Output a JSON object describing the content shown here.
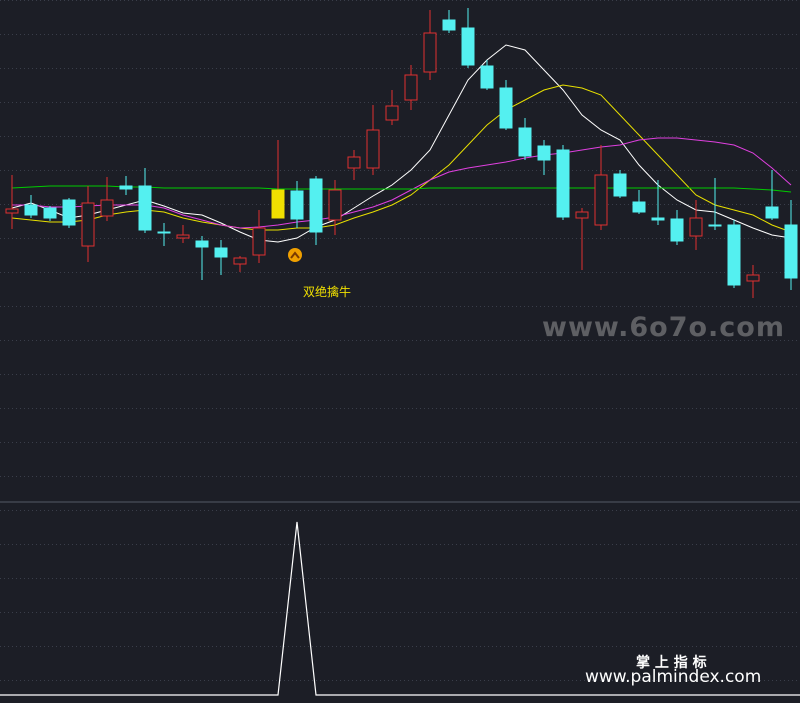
{
  "chart_data": [
    {
      "type": "candlestick",
      "panel": "price",
      "annotation": {
        "text": "双绝擒牛",
        "color": "#f0e000",
        "at_index": 15
      },
      "marker": {
        "type": "up-arrow-circle",
        "color": "#f0a000",
        "at_index": 15
      },
      "candles": [
        {
          "o": 209,
          "c": 213,
          "h": 229,
          "l": 175,
          "up": true
        },
        {
          "o": 205,
          "c": 215,
          "h": 218,
          "l": 195,
          "up": false
        },
        {
          "o": 208,
          "c": 218,
          "h": 221,
          "l": 206,
          "up": false
        },
        {
          "o": 200,
          "c": 225,
          "h": 228,
          "l": 198,
          "up": false
        },
        {
          "o": 203,
          "c": 246,
          "h": 262,
          "l": 186,
          "up": true
        },
        {
          "o": 200,
          "c": 216,
          "h": 221,
          "l": 177,
          "up": true
        },
        {
          "o": 186,
          "c": 189,
          "h": 195,
          "l": 176,
          "up": false
        },
        {
          "o": 186,
          "c": 230,
          "h": 233,
          "l": 168,
          "up": false
        },
        {
          "o": 232,
          "c": 232,
          "h": 246,
          "l": 223,
          "up": false
        },
        {
          "o": 235,
          "c": 238,
          "h": 243,
          "l": 225,
          "up": true
        },
        {
          "o": 241,
          "c": 247,
          "h": 280,
          "l": 236,
          "up": false
        },
        {
          "o": 248,
          "c": 257,
          "h": 275,
          "l": 240,
          "up": false
        },
        {
          "o": 258,
          "c": 264,
          "h": 272,
          "l": 256,
          "up": true
        },
        {
          "o": 255,
          "c": 228,
          "h": 263,
          "l": 210,
          "up": true
        },
        {
          "o": 218,
          "c": 190,
          "h": 200,
          "l": 140,
          "up": true
        },
        {
          "o": 219,
          "c": 191,
          "h": 228,
          "l": 181,
          "up": false
        },
        {
          "o": 179,
          "c": 232,
          "h": 245,
          "l": 176,
          "up": false
        },
        {
          "o": 220,
          "c": 190,
          "h": 235,
          "l": 180,
          "up": true
        },
        {
          "o": 168,
          "c": 157,
          "h": 180,
          "l": 150,
          "up": true
        },
        {
          "o": 168,
          "c": 130,
          "h": 175,
          "l": 105,
          "up": true
        },
        {
          "o": 120,
          "c": 106,
          "h": 125,
          "l": 90,
          "up": true
        },
        {
          "o": 100,
          "c": 75,
          "h": 110,
          "l": 65,
          "up": true
        },
        {
          "o": 72,
          "c": 33,
          "h": 80,
          "l": 10,
          "up": true
        },
        {
          "o": 30,
          "c": 20,
          "h": 33,
          "l": 10,
          "up": false
        },
        {
          "o": 28,
          "c": 65,
          "h": 68,
          "l": 8,
          "up": false
        },
        {
          "o": 66,
          "c": 88,
          "h": 90,
          "l": 60,
          "up": false
        },
        {
          "o": 88,
          "c": 128,
          "h": 130,
          "l": 80,
          "up": false
        },
        {
          "o": 128,
          "c": 156,
          "h": 160,
          "l": 118,
          "up": false
        },
        {
          "o": 146,
          "c": 160,
          "h": 175,
          "l": 140,
          "up": false
        },
        {
          "o": 150,
          "c": 217,
          "h": 220,
          "l": 145,
          "up": false
        },
        {
          "o": 218,
          "c": 212,
          "h": 270,
          "l": 208,
          "up": true
        },
        {
          "o": 225,
          "c": 175,
          "h": 145,
          "l": 230,
          "up": true
        },
        {
          "o": 174,
          "c": 196,
          "h": 198,
          "l": 170,
          "up": false
        },
        {
          "o": 202,
          "c": 212,
          "h": 214,
          "l": 190,
          "up": false
        },
        {
          "o": 220,
          "c": 218,
          "h": 225,
          "l": 180,
          "up": false
        },
        {
          "o": 219,
          "c": 241,
          "h": 245,
          "l": 210,
          "up": false
        },
        {
          "o": 236,
          "c": 218,
          "h": 250,
          "l": 200,
          "up": true
        },
        {
          "o": 225,
          "c": 225,
          "h": 230,
          "l": 178,
          "up": false
        },
        {
          "o": 225,
          "c": 285,
          "h": 288,
          "l": 220,
          "up": false
        },
        {
          "o": 281,
          "c": 275,
          "h": 298,
          "l": 265,
          "up": true
        },
        {
          "o": 218,
          "c": 207,
          "h": 220,
          "l": 170,
          "up": false
        },
        {
          "o": 225,
          "c": 278,
          "h": 290,
          "l": 200,
          "up": false
        }
      ],
      "series": [
        {
          "color": "#ffffff",
          "values": [
            208,
            203,
            210,
            218,
            215,
            210,
            205,
            200,
            206,
            213,
            215,
            223,
            232,
            240,
            242,
            238,
            227,
            220,
            208,
            196,
            185,
            170,
            150,
            115,
            80,
            60,
            45,
            50,
            70,
            90,
            115,
            130,
            140,
            165,
            185,
            200,
            210,
            212,
            220,
            228,
            235,
            238
          ]
        },
        {
          "color": "#e8e000",
          "values": [
            218,
            220,
            222,
            222,
            220,
            215,
            212,
            210,
            212,
            218,
            222,
            225,
            228,
            230,
            230,
            228,
            228,
            225,
            218,
            212,
            205,
            195,
            180,
            165,
            145,
            125,
            110,
            100,
            90,
            85,
            88,
            95,
            115,
            135,
            155,
            175,
            195,
            205,
            210,
            215,
            225,
            232
          ]
        },
        {
          "color": "#e040e0",
          "values": [
            205,
            205,
            207,
            207,
            206,
            205,
            205,
            205,
            208,
            215,
            220,
            225,
            228,
            227,
            225,
            222,
            220,
            217,
            212,
            207,
            200,
            190,
            180,
            172,
            168,
            165,
            162,
            158,
            155,
            153,
            150,
            147,
            145,
            140,
            138,
            138,
            140,
            142,
            145,
            153,
            168,
            185
          ]
        },
        {
          "color": "#00cc00",
          "values": [
            188,
            187,
            186,
            186,
            186,
            186,
            187,
            187,
            188,
            188,
            188,
            188,
            188,
            188,
            189,
            189,
            189,
            189,
            189,
            189,
            189,
            189,
            188,
            188,
            188,
            188,
            188,
            188,
            188,
            188,
            188,
            188,
            188,
            188,
            188,
            188,
            188,
            188,
            188,
            189,
            190,
            192
          ]
        }
      ]
    },
    {
      "type": "line",
      "panel": "indicator",
      "color": "#ffffff",
      "values": [
        0,
        0,
        0,
        0,
        0,
        0,
        0,
        0,
        0,
        0,
        0,
        0,
        0,
        0,
        0,
        1,
        0,
        0,
        0,
        0,
        0,
        0,
        0,
        0,
        0,
        0,
        0,
        0,
        0,
        0,
        0,
        0,
        0,
        0,
        0,
        0,
        0,
        0,
        0,
        0,
        0,
        0
      ]
    }
  ],
  "watermarks": {
    "site1": "www.6o7o.com",
    "brand": "掌 上 指 标",
    "site2": "www.palmindex.com"
  }
}
